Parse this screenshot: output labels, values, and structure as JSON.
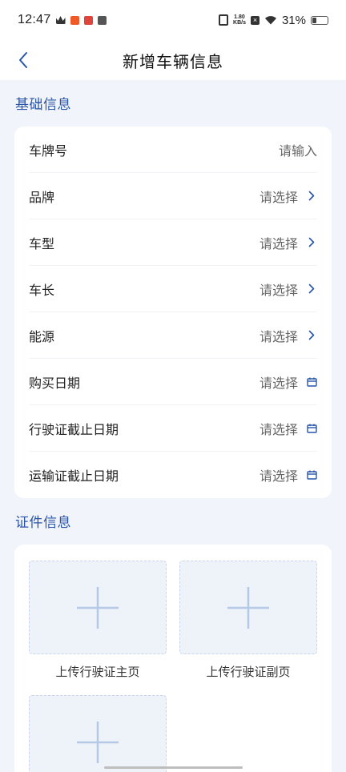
{
  "status_bar": {
    "time": "12:47",
    "net_speed_value": "1.80",
    "net_speed_unit": "KB/s",
    "battery": "31%",
    "battery_level": 0.31,
    "icons": [
      "crown-icon",
      "app-notification-icon",
      "app-notification-icon",
      "app-notification-icon",
      "vibrate-icon",
      "no-sim-icon",
      "wifi-icon",
      "battery-icon"
    ]
  },
  "header": {
    "title": "新增车辆信息",
    "back_icon": "chevron-left-icon"
  },
  "basic_info": {
    "section_title": "基础信息",
    "rows": [
      {
        "label": "车牌号",
        "value": "请输入",
        "icon": "none"
      },
      {
        "label": "品牌",
        "value": "请选择",
        "icon": "chevron-right-icon"
      },
      {
        "label": "车型",
        "value": "请选择",
        "icon": "chevron-right-icon"
      },
      {
        "label": "车长",
        "value": "请选择",
        "icon": "chevron-right-icon"
      },
      {
        "label": "能源",
        "value": "请选择",
        "icon": "chevron-right-icon"
      },
      {
        "label": "购买日期",
        "value": "请选择",
        "icon": "calendar-icon"
      },
      {
        "label": "行驶证截止日期",
        "value": "请选择",
        "icon": "calendar-icon"
      },
      {
        "label": "运输证截止日期",
        "value": "请选择",
        "icon": "calendar-icon"
      }
    ]
  },
  "documents": {
    "section_title": "证件信息",
    "uploads": [
      {
        "label": "上传行驶证主页",
        "icon": "plus-icon"
      },
      {
        "label": "上传行驶证副页",
        "icon": "plus-icon"
      },
      {
        "label": "",
        "icon": "plus-icon"
      }
    ]
  },
  "colors": {
    "accent": "#2855a7",
    "page_background": "#f2f4fb",
    "card_background": "#ffffff",
    "upload_background": "#eef3fa",
    "plus": "#b3c9e6"
  }
}
